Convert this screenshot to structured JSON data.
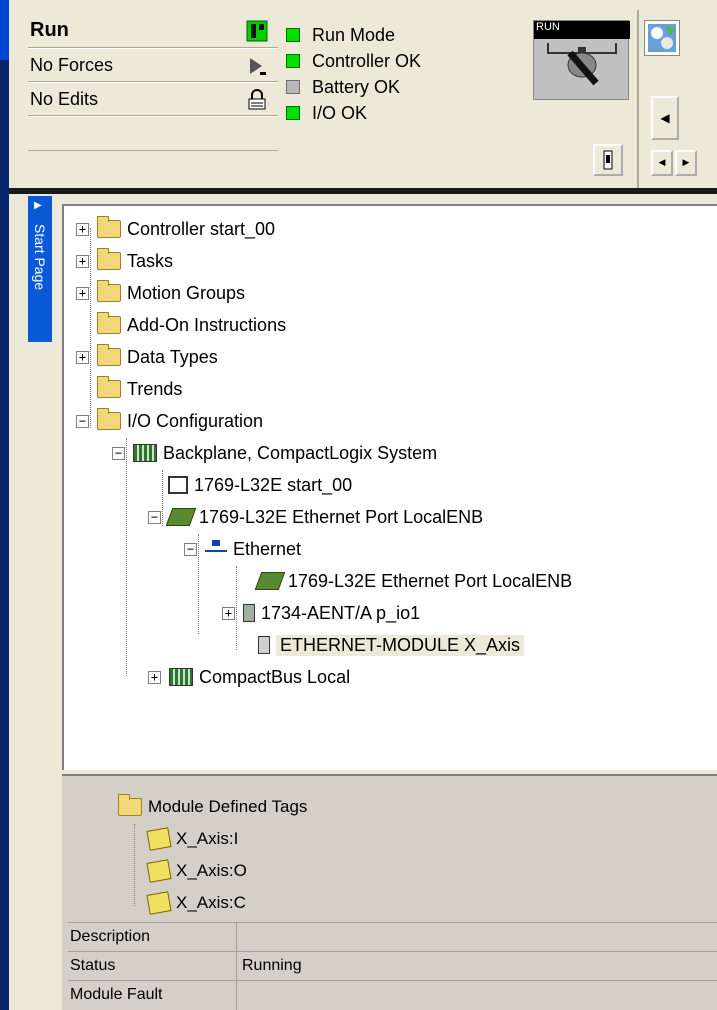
{
  "status": {
    "mode": "Run",
    "forces": "No Forces",
    "edits": "No Edits"
  },
  "indicators": [
    {
      "label": "Run Mode",
      "color": "#00e000"
    },
    {
      "label": "Controller OK",
      "color": "#00e000"
    },
    {
      "label": "Battery OK",
      "color": "#b8b8b8"
    },
    {
      "label": "I/O OK",
      "color": "#00e000"
    }
  ],
  "keyswitch": {
    "label": "RUN"
  },
  "start_tab": {
    "label": "Start Page"
  },
  "tree": {
    "items": [
      {
        "label": "Controller start_00"
      },
      {
        "label": "Tasks"
      },
      {
        "label": "Motion Groups"
      },
      {
        "label": "Add-On Instructions"
      },
      {
        "label": "Data Types"
      },
      {
        "label": "Trends"
      },
      {
        "label": "I/O Configuration"
      },
      {
        "label": "Backplane, CompactLogix System"
      },
      {
        "label": "1769-L32E start_00"
      },
      {
        "label": "1769-L32E Ethernet Port LocalENB"
      },
      {
        "label": "Ethernet"
      },
      {
        "label": "1769-L32E Ethernet Port LocalENB"
      },
      {
        "label": "1734-AENT/A p_io1"
      },
      {
        "label": "ETHERNET-MODULE X_Axis"
      },
      {
        "label": "CompactBus Local"
      }
    ]
  },
  "tags": {
    "folder": "Module Defined Tags",
    "items": [
      "X_Axis:I",
      "X_Axis:O",
      "X_Axis:C"
    ]
  },
  "properties": [
    {
      "key": "Description",
      "value": ""
    },
    {
      "key": "Status",
      "value": "Running"
    },
    {
      "key": "Module Fault",
      "value": ""
    }
  ]
}
